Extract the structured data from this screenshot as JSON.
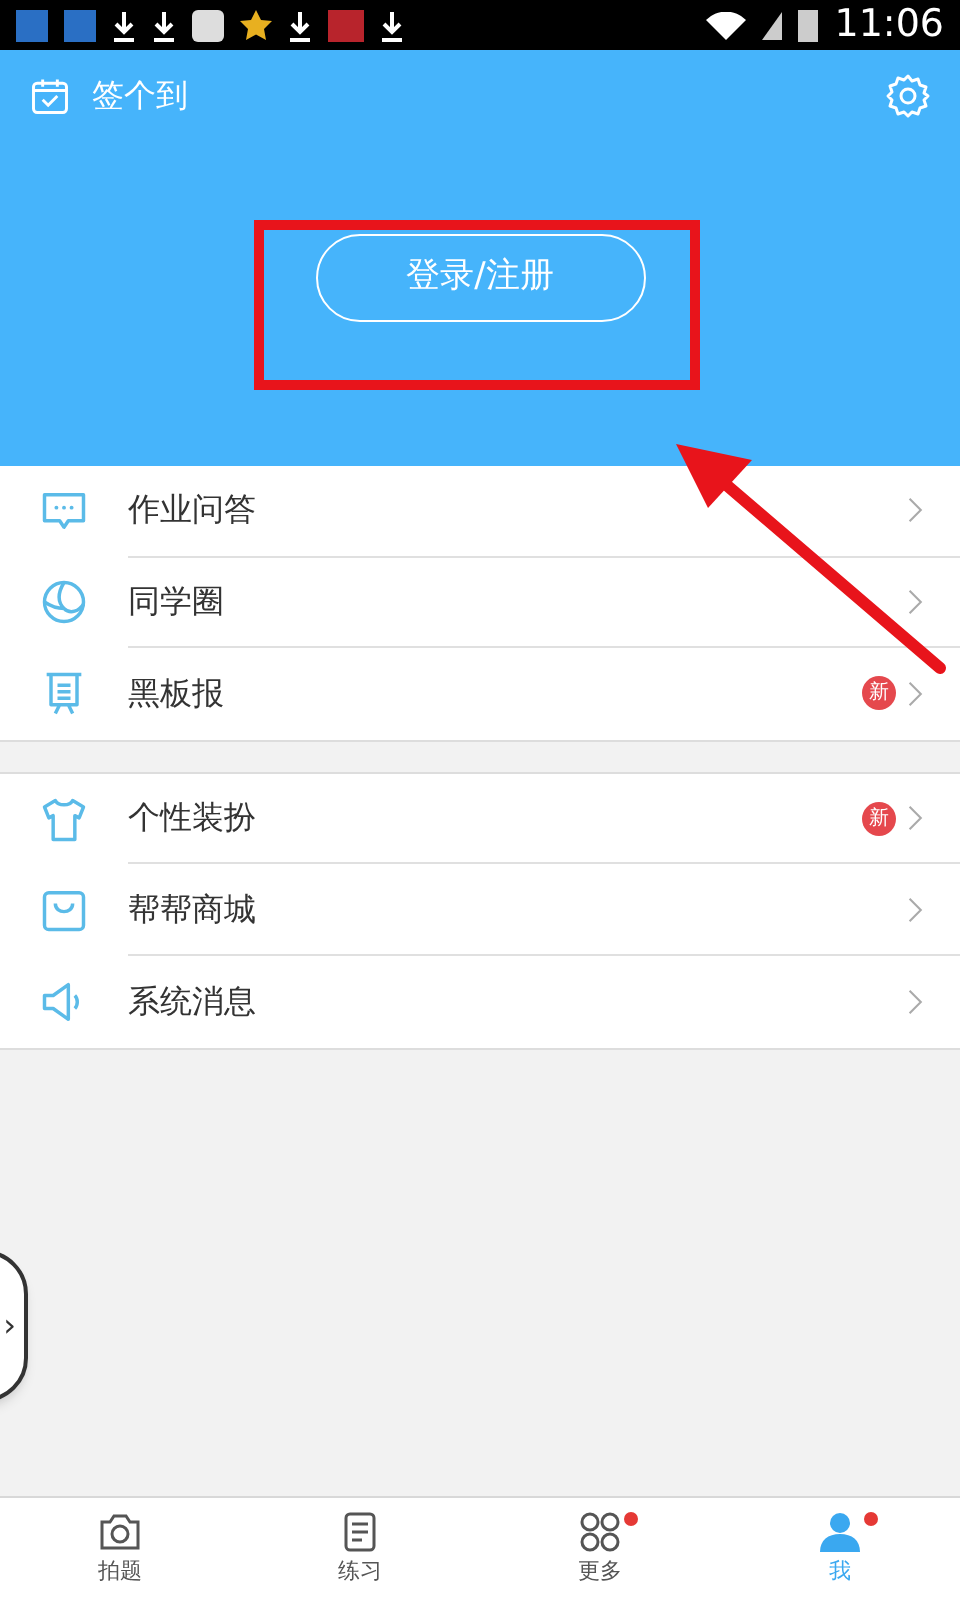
{
  "status_bar": {
    "time": "11:06"
  },
  "header": {
    "checkin": "签个到",
    "login_button": "登录/注册"
  },
  "menu_groups": [
    [
      {
        "label": "作业问答"
      },
      {
        "label": "同学圈"
      },
      {
        "label": "黑板报",
        "badge": "新"
      }
    ],
    [
      {
        "label": "个性装扮",
        "badge": "新"
      },
      {
        "label": "帮帮商城"
      },
      {
        "label": "系统消息"
      }
    ]
  ],
  "floating_handle": {
    "label": "›"
  },
  "tabs": [
    {
      "label": "拍题",
      "selected": false,
      "dot": false
    },
    {
      "label": "练习",
      "selected": false,
      "dot": false
    },
    {
      "label": "更多",
      "selected": false,
      "dot": true
    },
    {
      "label": "我",
      "selected": true,
      "dot": true
    }
  ]
}
